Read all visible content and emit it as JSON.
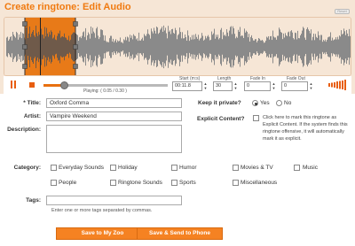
{
  "header": {
    "title": "Create ringtone: Edit Audio",
    "reset_label": "Reset"
  },
  "player": {
    "playing_text": "Playing: ( 0.05 / 0.30 )",
    "progress": 0.17,
    "start_label": "Start (m:s)",
    "start_value": "00:11.8",
    "length_label": "Length",
    "length_value": "30",
    "fade_in_label": "Fade In",
    "fade_in_value": "0",
    "fade_out_label": "Fade Out",
    "fade_out_value": "0"
  },
  "form": {
    "title_label": "* Title:",
    "title_value": "Oxford Comma",
    "artist_label": "Artist:",
    "artist_value": "Vampire Weekend",
    "description_label": "Description:",
    "private_label": "Keep it private?",
    "private_yes": "Yes",
    "private_no": "No",
    "explicit_label": "Explicit Content?",
    "explicit_text": "Click here to mark this ringtone as Explicit Content. If the system finds this ringtone offensive, it will automatically mark it as explicit.",
    "category_label": "Category:",
    "categories": [
      "Everyday Sounds",
      "Holiday",
      "Humor",
      "Movies & TV",
      "Music",
      "People",
      "Ringtone Sounds",
      "Sports",
      "Miscellaneous"
    ],
    "tags_label": "Tags:",
    "tags_hint": "Enter one or more tags separated by commas."
  },
  "buttons": {
    "save_label": "Save to My Zoo",
    "send_label": "Save & Send to Phone"
  },
  "colors": {
    "accent": "#f58222",
    "title": "#f07a10",
    "background": "#f6e6d6"
  }
}
